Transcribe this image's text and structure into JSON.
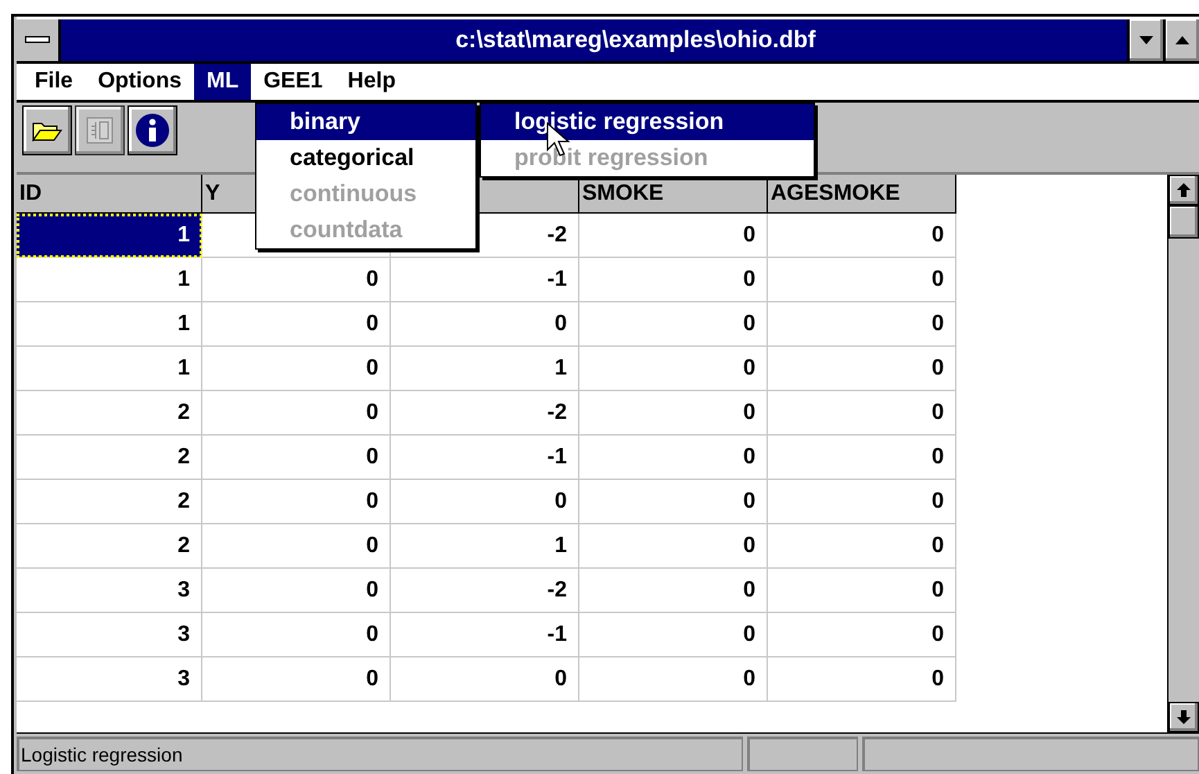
{
  "window": {
    "title": "c:\\stat\\mareg\\examples\\ohio.dbf"
  },
  "menu_bar": [
    {
      "label": "File",
      "selected": false
    },
    {
      "label": "Options",
      "selected": false
    },
    {
      "label": "ML",
      "selected": true
    },
    {
      "label": "GEE1",
      "selected": false
    },
    {
      "label": "Help",
      "selected": false
    }
  ],
  "toolbar": [
    {
      "kind": "open",
      "disabled": false
    },
    {
      "kind": "grid",
      "disabled": true
    },
    {
      "kind": "info",
      "disabled": false
    }
  ],
  "ml_menu": [
    {
      "label": "binary",
      "selected": true,
      "disabled": false
    },
    {
      "label": "categorical",
      "selected": false,
      "disabled": false
    },
    {
      "label": "continuous",
      "selected": false,
      "disabled": true
    },
    {
      "label": "countdata",
      "selected": false,
      "disabled": true
    }
  ],
  "binary_submenu": [
    {
      "label": "logistic regression",
      "selected": true,
      "disabled": false
    },
    {
      "label": "probit regression",
      "selected": false,
      "disabled": true
    }
  ],
  "table": {
    "columns": [
      "ID",
      "Y",
      "",
      "SMOKE",
      "AGESMOKE"
    ],
    "rows": [
      {
        "cells": [
          "1",
          "",
          "-2",
          "0",
          "0"
        ],
        "selected": true
      },
      {
        "cells": [
          "1",
          "0",
          "-1",
          "0",
          "0"
        ],
        "selected": false
      },
      {
        "cells": [
          "1",
          "0",
          "0",
          "0",
          "0"
        ],
        "selected": false
      },
      {
        "cells": [
          "1",
          "0",
          "1",
          "0",
          "0"
        ],
        "selected": false
      },
      {
        "cells": [
          "2",
          "0",
          "-2",
          "0",
          "0"
        ],
        "selected": false
      },
      {
        "cells": [
          "2",
          "0",
          "-1",
          "0",
          "0"
        ],
        "selected": false
      },
      {
        "cells": [
          "2",
          "0",
          "0",
          "0",
          "0"
        ],
        "selected": false
      },
      {
        "cells": [
          "2",
          "0",
          "1",
          "0",
          "0"
        ],
        "selected": false
      },
      {
        "cells": [
          "3",
          "0",
          "-2",
          "0",
          "0"
        ],
        "selected": false
      },
      {
        "cells": [
          "3",
          "0",
          "-1",
          "0",
          "0"
        ],
        "selected": false
      },
      {
        "cells": [
          "3",
          "0",
          "0",
          "0",
          "0"
        ],
        "selected": false
      }
    ]
  },
  "status_bar": [
    "Logistic regression"
  ]
}
